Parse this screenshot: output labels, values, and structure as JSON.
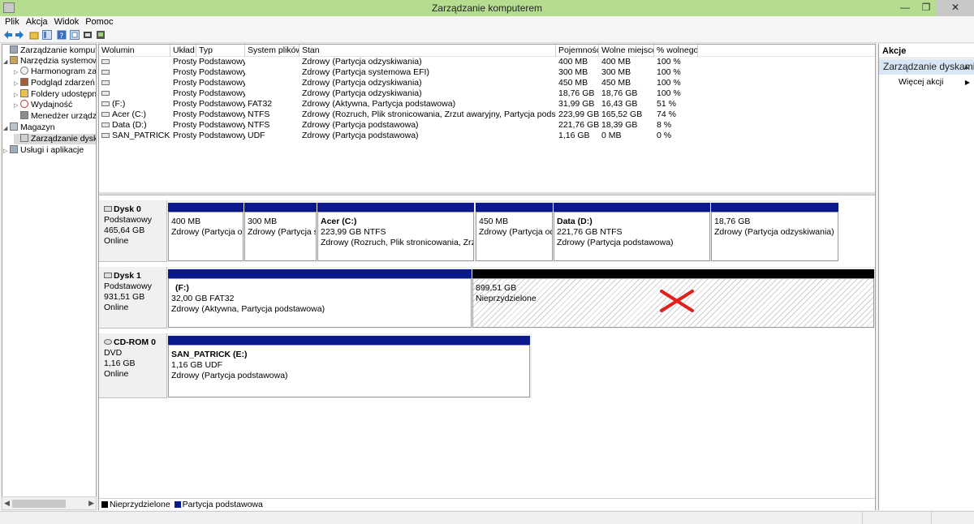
{
  "window": {
    "title": "Zarządzanie komputerem",
    "minimize": "—",
    "maximize": "❐",
    "close": "✕"
  },
  "menu": [
    "Plik",
    "Akcja",
    "Widok",
    "Pomoc"
  ],
  "tree": [
    {
      "label": "Zarządzanie komputerem",
      "level": 0,
      "exp": ""
    },
    {
      "label": "Narzędzia systemowe",
      "level": 1,
      "exp": "◢"
    },
    {
      "label": "Harmonogram zadań",
      "level": 2,
      "exp": "▷"
    },
    {
      "label": "Podgląd zdarzeń",
      "level": 2,
      "exp": "▷"
    },
    {
      "label": "Foldery udostępnione",
      "level": 2,
      "exp": "▷"
    },
    {
      "label": "Wydajność",
      "level": 2,
      "exp": "▷"
    },
    {
      "label": "Menedżer urządzeń",
      "level": 2,
      "exp": ""
    },
    {
      "label": "Magazyn",
      "level": 1,
      "exp": "◢"
    },
    {
      "label": "Zarządzanie dyskami",
      "level": 2,
      "exp": "",
      "selected": true
    },
    {
      "label": "Usługi i aplikacje",
      "level": 1,
      "exp": "▷"
    }
  ],
  "volumes": {
    "headers": [
      "Wolumin",
      "Układ",
      "Typ",
      "System plików",
      "Stan",
      "Pojemność",
      "Wolne miejsce",
      "% wolnego"
    ],
    "rows": [
      [
        "",
        "Prosty",
        "Podstawowy",
        "",
        "Zdrowy (Partycja odzyskiwania)",
        "400 MB",
        "400 MB",
        "100 %"
      ],
      [
        "",
        "Prosty",
        "Podstawowy",
        "",
        "Zdrowy (Partycja systemowa EFI)",
        "300 MB",
        "300 MB",
        "100 %"
      ],
      [
        "",
        "Prosty",
        "Podstawowy",
        "",
        "Zdrowy (Partycja odzyskiwania)",
        "450 MB",
        "450 MB",
        "100 %"
      ],
      [
        "",
        "Prosty",
        "Podstawowy",
        "",
        "Zdrowy (Partycja odzyskiwania)",
        "18,76 GB",
        "18,76 GB",
        "100 %"
      ],
      [
        "(F:)",
        "Prosty",
        "Podstawowy",
        "FAT32",
        "Zdrowy (Aktywna, Partycja podstawowa)",
        "31,99 GB",
        "16,43 GB",
        "51 %"
      ],
      [
        "Acer (C:)",
        "Prosty",
        "Podstawowy",
        "NTFS",
        "Zdrowy (Rozruch, Plik stronicowania, Zrzut awaryjny, Partycja podstawowa)",
        "223,99 GB",
        "165,52 GB",
        "74 %"
      ],
      [
        "Data (D:)",
        "Prosty",
        "Podstawowy",
        "NTFS",
        "Zdrowy (Partycja podstawowa)",
        "221,76 GB",
        "18,39 GB",
        "8 %"
      ],
      [
        "SAN_PATRICK (E:)",
        "Prosty",
        "Podstawowy",
        "UDF",
        "Zdrowy (Partycja podstawowa)",
        "1,16 GB",
        "0 MB",
        "0 %"
      ]
    ]
  },
  "disks": [
    {
      "name": "Dysk 0",
      "type": "Podstawowy",
      "size": "465,64 GB",
      "status": "Online",
      "partitions": [
        {
          "title": "",
          "size": "400 MB",
          "status": "Zdrowy (Partycja odzyskiwania)"
        },
        {
          "title": "",
          "size": "300 MB",
          "status": "Zdrowy (Partycja systemowa EFI)"
        },
        {
          "title": "Acer  (C:)",
          "size": "223,99 GB NTFS",
          "status": "Zdrowy (Rozruch, Plik stronicowania, Zrzut awaryjny, Partycja podstawowa)"
        },
        {
          "title": "",
          "size": "450 MB",
          "status": "Zdrowy (Partycja odzyskiwania)"
        },
        {
          "title": "Data  (D:)",
          "size": "221,76 GB NTFS",
          "status": "Zdrowy (Partycja podstawowa)"
        },
        {
          "title": "",
          "size": "18,76 GB",
          "status": "Zdrowy (Partycja odzyskiwania)"
        }
      ]
    },
    {
      "name": "Dysk 1",
      "type": "Podstawowy",
      "size": "931,51 GB",
      "status": "Online",
      "partitions": [
        {
          "title": "(F:)",
          "size": "32,00 GB FAT32",
          "status": "Zdrowy (Aktywna, Partycja podstawowa)"
        },
        {
          "title": "",
          "size": "899,51 GB",
          "status": "Nieprzydzielone"
        }
      ]
    },
    {
      "name": "CD-ROM 0",
      "type": "DVD",
      "size": "1,16 GB",
      "status": "Online",
      "partitions": [
        {
          "title": "SAN_PATRICK  (E:)",
          "size": "1,16 GB UDF",
          "status": "Zdrowy (Partycja podstawowa)"
        }
      ]
    }
  ],
  "legend": [
    {
      "label": "Nieprzydzielone",
      "color": "#000000"
    },
    {
      "label": "Partycja podstawowa",
      "color": "#0a1a8c"
    }
  ],
  "actions": {
    "header": "Akcje",
    "section": "Zarządzanie dyskami",
    "section_arrow": "▲",
    "more": "Więcej akcji",
    "more_arrow": "▶"
  },
  "colors": {
    "titlebar": "#b6dc90",
    "primary_partition": "#0a1a8c",
    "unallocated": "#000000",
    "marker": "#e0201a"
  }
}
